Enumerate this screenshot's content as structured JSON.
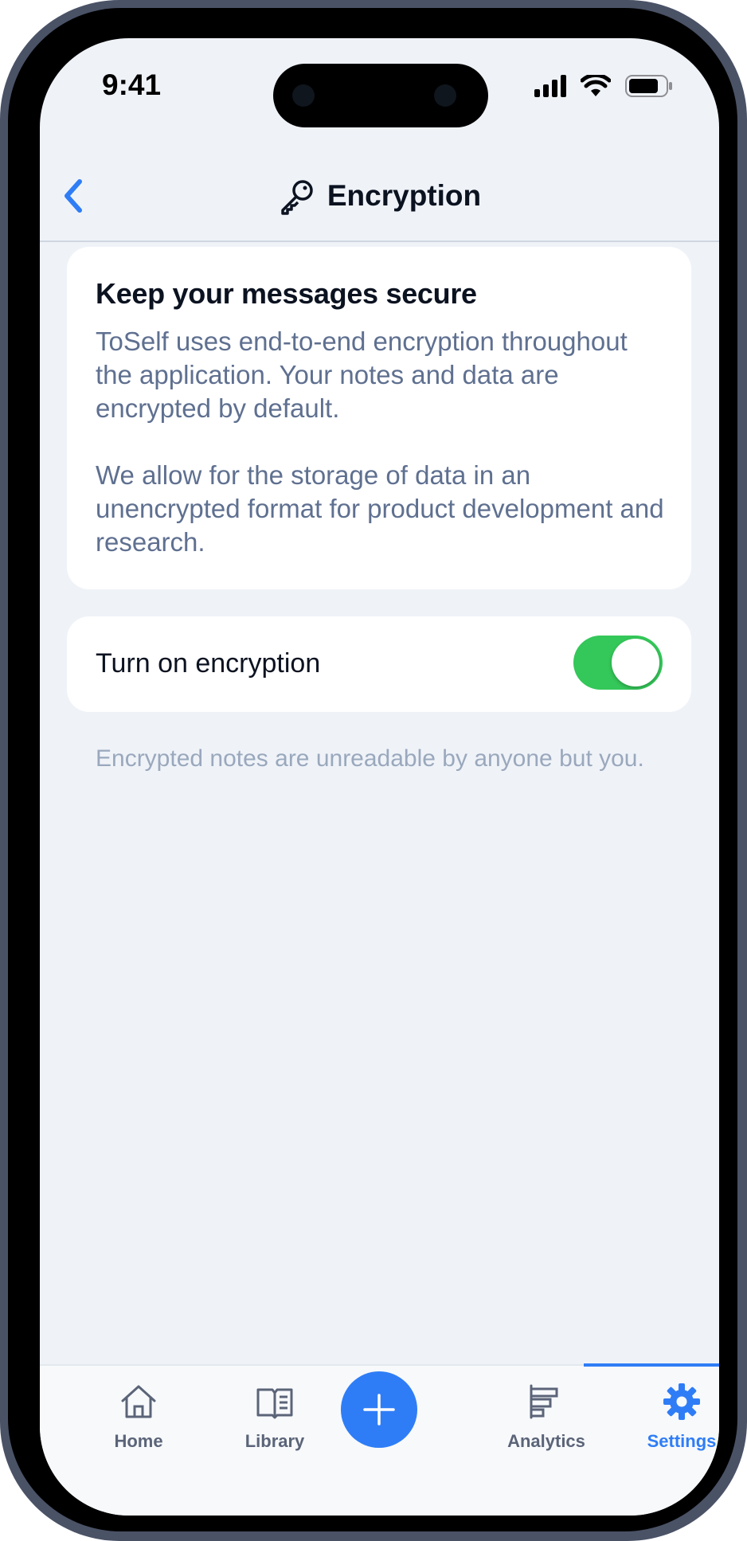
{
  "status": {
    "time": "9:41"
  },
  "nav": {
    "title": "Encryption"
  },
  "intro_card": {
    "heading": "Keep your messages secure",
    "paragraph1": "ToSelf uses end-to-end encryption throughout the application. Your notes and data are encrypted by default.",
    "paragraph2": "We allow for the storage of data in an unencrypted format for product development and research."
  },
  "setting": {
    "label": "Turn on encryption",
    "enabled": true
  },
  "footnote": "Encrypted notes are unreadable by anyone but you.",
  "tabs": [
    {
      "label": "Home",
      "icon": "home-icon"
    },
    {
      "label": "Library",
      "icon": "book-icon"
    },
    {
      "label": "",
      "icon": "plus-icon"
    },
    {
      "label": "Analytics",
      "icon": "analytics-icon"
    },
    {
      "label": "Settings",
      "icon": "gear-icon",
      "active": true
    }
  ],
  "colors": {
    "accent": "#2f7df6",
    "toggle_on": "#34c759",
    "background": "#eff3f8"
  }
}
